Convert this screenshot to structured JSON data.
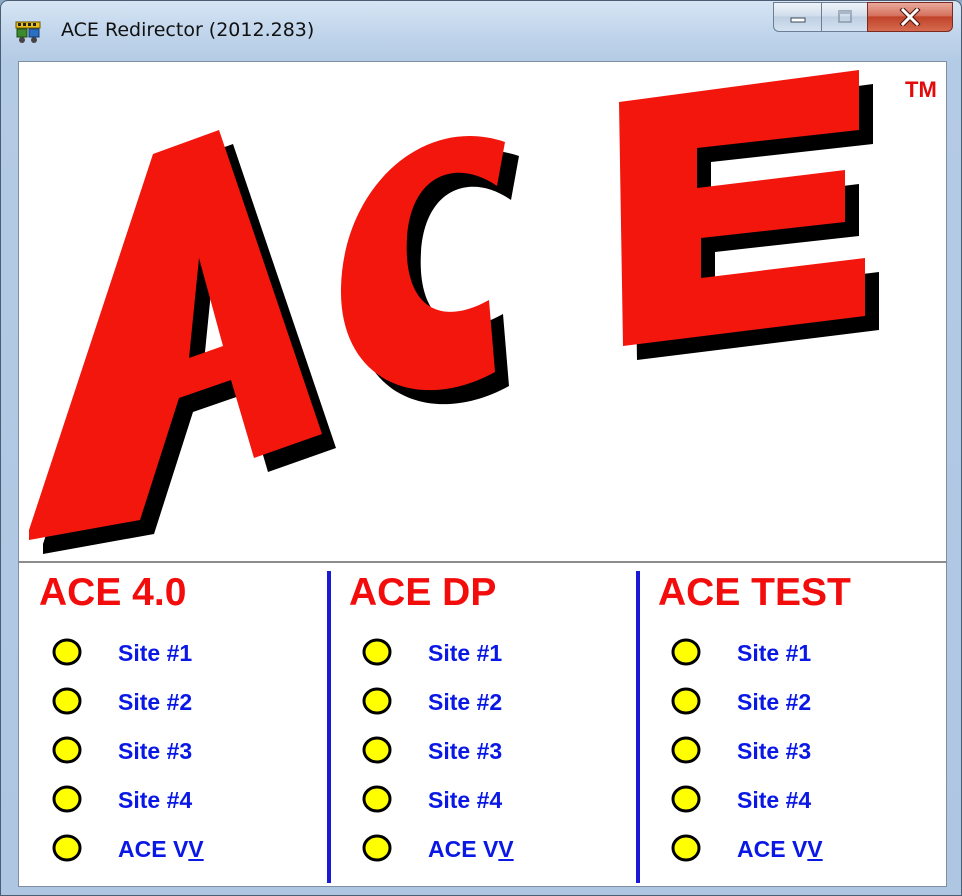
{
  "window": {
    "title": "ACE Redirector (2012.283)",
    "icon": "app-icon",
    "buttons": [
      "minimize",
      "maximize",
      "close"
    ]
  },
  "logo": {
    "text": "ACE",
    "trademark": "TM",
    "colors": {
      "fill": "#f2160c",
      "shadow": "#000000"
    }
  },
  "columns": [
    {
      "title": "ACE 4.0",
      "links": [
        {
          "label": "Site #1",
          "status": "yellow"
        },
        {
          "label": "Site #2",
          "status": "yellow"
        },
        {
          "label": "Site #3",
          "status": "yellow"
        },
        {
          "label": "Site #4",
          "status": "yellow"
        },
        {
          "label": "ACE VV",
          "label_main": "ACE V",
          "label_underlined": "V",
          "status": "yellow"
        }
      ]
    },
    {
      "title": "ACE DP",
      "links": [
        {
          "label": "Site #1",
          "status": "yellow"
        },
        {
          "label": "Site #2",
          "status": "yellow"
        },
        {
          "label": "Site #3",
          "status": "yellow"
        },
        {
          "label": "Site #4",
          "status": "yellow"
        },
        {
          "label": "ACE VV",
          "label_main": "ACE V",
          "label_underlined": "V",
          "status": "yellow"
        }
      ]
    },
    {
      "title": "ACE TEST",
      "links": [
        {
          "label": "Site #1",
          "status": "yellow"
        },
        {
          "label": "Site #2",
          "status": "yellow"
        },
        {
          "label": "Site #3",
          "status": "yellow"
        },
        {
          "label": "Site #4",
          "status": "yellow"
        },
        {
          "label": "ACE VV",
          "label_main": "ACE V",
          "label_underlined": "V",
          "status": "yellow"
        }
      ]
    }
  ],
  "colors": {
    "title_red": "#f20c0c",
    "link_blue": "#0a18e6",
    "separator_blue": "#1a1ad6",
    "status_yellow": "#ffff00"
  }
}
